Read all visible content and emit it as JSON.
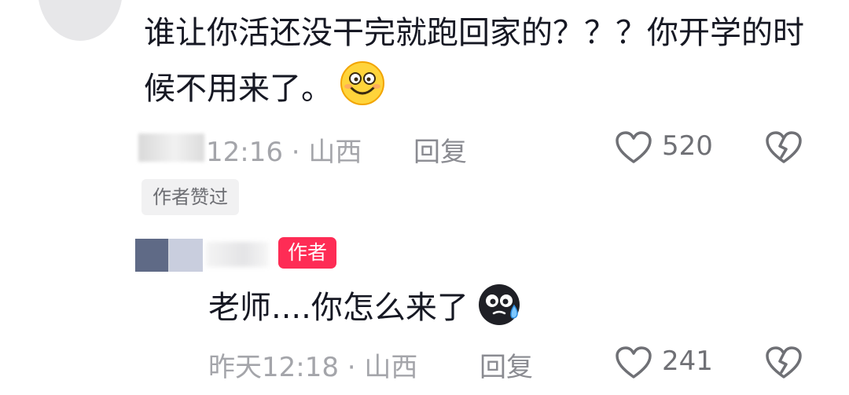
{
  "comment1": {
    "text": "谁让你活还没干完就跑回家的？？？你开学的时候不用来了。",
    "emoji": "smile-emoji",
    "meta": "12:16 · 山西",
    "reply_label": "回复",
    "likes": "520",
    "liked_by_author": "作者赞过"
  },
  "comment2": {
    "author_badge": "作者",
    "text": "老师....你怎么来了",
    "emoji": "sweat-emoji",
    "meta": "昨天12:18 · 山西",
    "reply_label": "回复",
    "likes": "241"
  },
  "icons": {
    "like": "heart-icon",
    "dislike": "broken-heart-icon"
  },
  "colors": {
    "author_badge": "#fe2c55",
    "text": "#161823",
    "meta": "#a4a5aa"
  }
}
